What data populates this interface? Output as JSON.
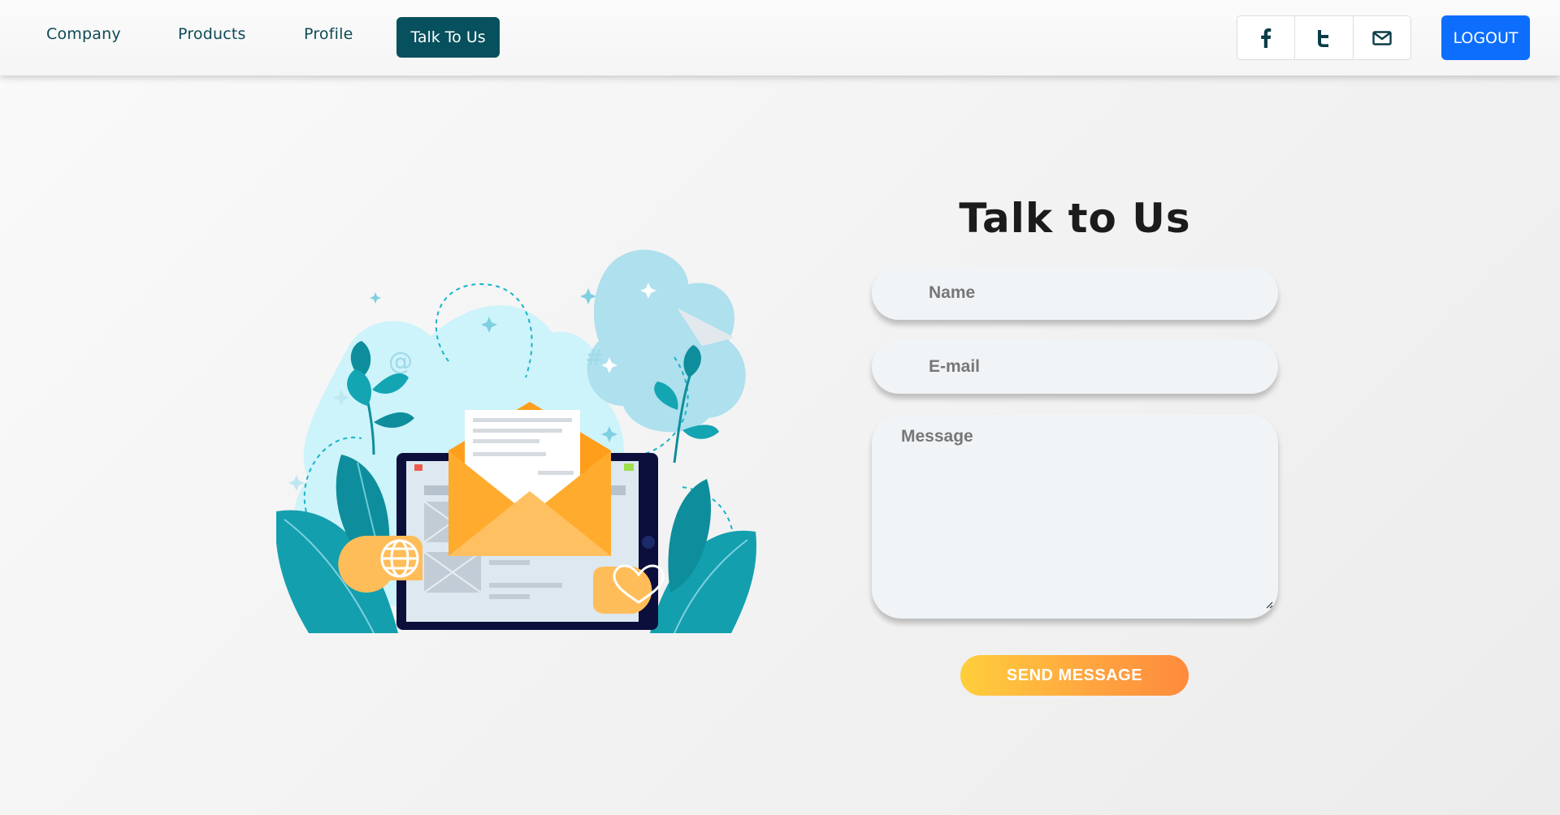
{
  "nav": {
    "links": [
      {
        "label": "Company"
      },
      {
        "label": "Products"
      },
      {
        "label": "Profile"
      }
    ],
    "active_label": "Talk To Us",
    "social": [
      "facebook-icon",
      "tumblr-icon",
      "mail-icon"
    ],
    "logout_label": "LOGOUT"
  },
  "form": {
    "title": "Talk to Us",
    "name_placeholder": "Name",
    "email_placeholder": "E-mail",
    "message_placeholder": "Message",
    "submit_label": "SEND MESSAGE"
  },
  "colors": {
    "nav_text": "#0d4a55",
    "nav_active_bg": "#07505d",
    "logout_bg": "#0d6efd",
    "button_gradient_start": "#ffce3c",
    "button_gradient_end": "#ff8a3d",
    "teal": "#14a5b3",
    "orange": "#ffab2e"
  }
}
